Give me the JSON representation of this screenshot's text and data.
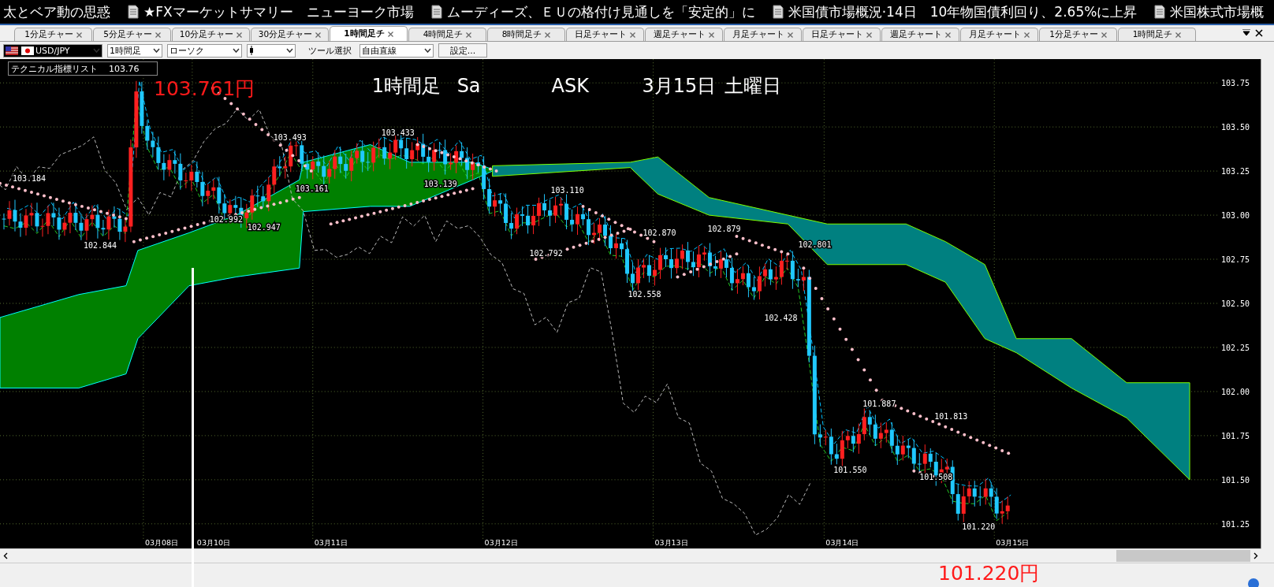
{
  "news_ticker": [
    "太とベア動の思惑",
    "★FXマーケットサマリー　ニューヨーク市場",
    "ムーディーズ、ＥＵの格付け見通しを「安定的」に",
    "米国債市場概況·14日　10年物国債利回り、2.65%に上昇",
    "米国株式市場概"
  ],
  "tabs": [
    {
      "label": "1分足チャー",
      "selected": false
    },
    {
      "label": "5分足チャー",
      "selected": false
    },
    {
      "label": "10分足チャー",
      "selected": false
    },
    {
      "label": "30分足チャー",
      "selected": false
    },
    {
      "label": "1時間足チ",
      "selected": true
    },
    {
      "label": "4時間足チ",
      "selected": false
    },
    {
      "label": "8時間足チ",
      "selected": false
    },
    {
      "label": "日足チャート",
      "selected": false
    },
    {
      "label": "週足チャート",
      "selected": false
    },
    {
      "label": "月足チャート",
      "selected": false
    },
    {
      "label": "日足チャート",
      "selected": false
    },
    {
      "label": "週足チャート",
      "selected": false
    },
    {
      "label": "月足チャート",
      "selected": false
    },
    {
      "label": "1分足チャー",
      "selected": false
    },
    {
      "label": "1時間足チ",
      "selected": false
    }
  ],
  "toolbar": {
    "symbol": "USD/JPY",
    "timeframe": "1時間足",
    "chart_type": "ローソク",
    "tool_label": "ツール選択",
    "tool": "自由直線",
    "settings_button": "設定..."
  },
  "indicator_list": {
    "label": "テクニカル指標リスト",
    "value": "103.76"
  },
  "chart": {
    "title": [
      "1時間足",
      "Sa",
      "ASK",
      "3月15日",
      "土曜日"
    ],
    "price_labels": [
      "103.184",
      "102.844",
      "103.493",
      "103.433",
      "103.161",
      "103.139",
      "102.992",
      "102.947",
      "103.110",
      "102.792",
      "102.870",
      "102.879",
      "102.558",
      "102.801",
      "102.428",
      "101.887",
      "101.813",
      "101.550",
      "101.508",
      "101.220"
    ],
    "y_axis": [
      "103.75",
      "103.50",
      "103.25",
      "103.00",
      "102.75",
      "102.50",
      "102.25",
      "102.00",
      "101.75",
      "101.50",
      "101.25"
    ],
    "x_axis": [
      "03月08日",
      "03月10日",
      "03月11日",
      "03月12日",
      "03月13日",
      "03月14日",
      "03月15日"
    ]
  },
  "annotations": [
    "103.761円",
    "101.220円"
  ]
}
